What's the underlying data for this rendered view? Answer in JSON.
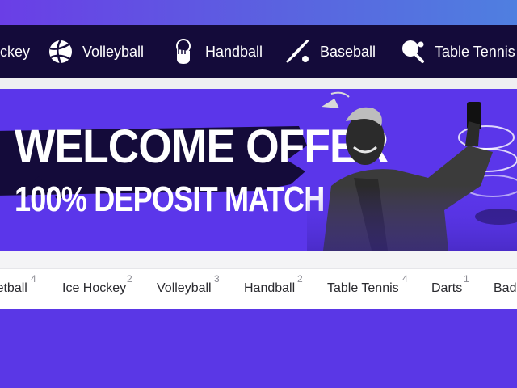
{
  "sport_nav": {
    "items": [
      {
        "label": "Ice Hockey",
        "icon": "hockey-icon"
      },
      {
        "label": "Volleyball",
        "icon": "volleyball-icon"
      },
      {
        "label": "Handball",
        "icon": "handball-icon"
      },
      {
        "label": "Baseball",
        "icon": "baseball-icon"
      },
      {
        "label": "Table Tennis",
        "icon": "table-tennis-icon"
      }
    ]
  },
  "banner": {
    "title": "WELCOME OFFER",
    "subtitle": "100% DEPOSIT MATCH"
  },
  "tabs": [
    {
      "label": "Basketball",
      "count": "4"
    },
    {
      "label": "Ice Hockey",
      "count": "2"
    },
    {
      "label": "Volleyball",
      "count": "3"
    },
    {
      "label": "Handball",
      "count": "2"
    },
    {
      "label": "Table Tennis",
      "count": "4"
    },
    {
      "label": "Darts",
      "count": "1"
    },
    {
      "label": "Badminton",
      "count": ""
    }
  ],
  "colors": {
    "nav_bg": "#140b3a",
    "brand_purple": "#5a37e6",
    "tab_text": "#2a2a2f"
  }
}
